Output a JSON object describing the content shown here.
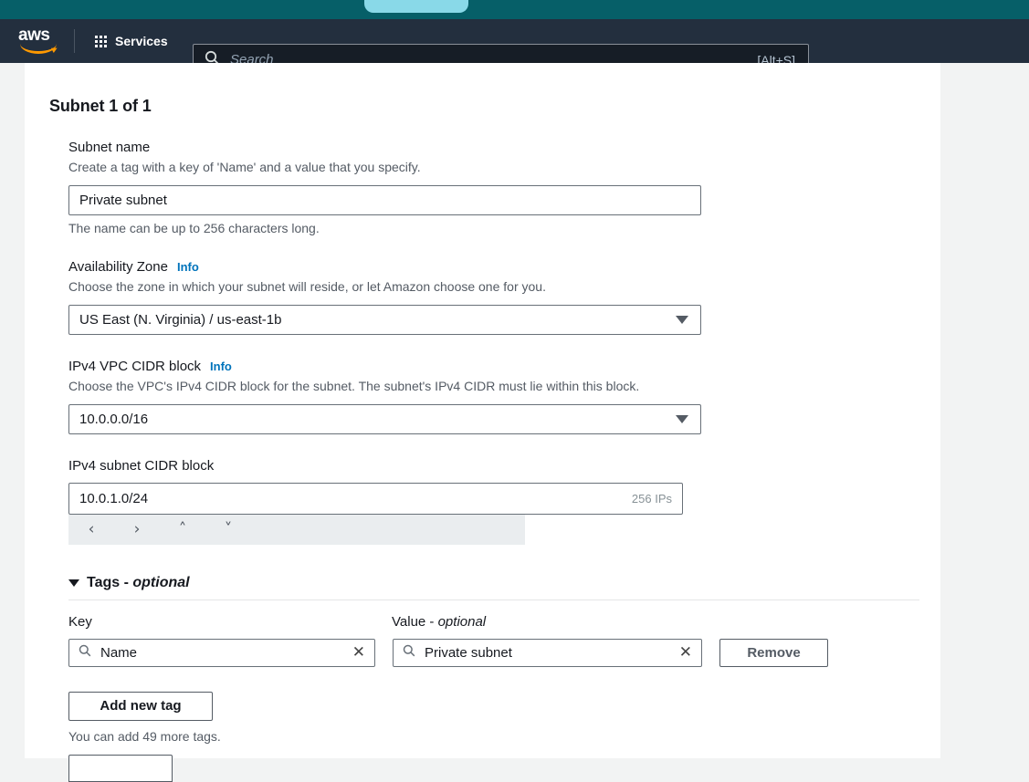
{
  "browser": {
    "tab_strip_color": "#065f68",
    "active_tab_color": "#89d9e8"
  },
  "header": {
    "logo_text": "aws",
    "services_label": "Services",
    "services_icon": "grid-icon",
    "search": {
      "icon": "search-icon",
      "placeholder": "Search",
      "shortcut": "[Alt+S]"
    }
  },
  "main": {
    "section_title": "Subnet 1 of 1",
    "fields": {
      "subnet_name": {
        "label": "Subnet name",
        "description": "Create a tag with a key of 'Name' and a value that you specify.",
        "value": "Private subnet",
        "hint": "The name can be up to 256 characters long."
      },
      "availability_zone": {
        "label": "Availability Zone",
        "info": "Info",
        "description": "Choose the zone in which your subnet will reside, or let Amazon choose one for you.",
        "value": "US East (N. Virginia) / us-east-1b"
      },
      "vpc_cidr": {
        "label": "IPv4 VPC CIDR block",
        "info": "Info",
        "description": "Choose the VPC's IPv4 CIDR block for the subnet. The subnet's IPv4 CIDR must lie within this block.",
        "value": "10.0.0.0/16"
      },
      "subnet_cidr": {
        "label": "IPv4 subnet CIDR block",
        "value": "10.0.1.0/24",
        "ip_count": "256 IPs",
        "stepper": {
          "prev": "‹",
          "next": "›",
          "up": "˄",
          "down": "˅"
        }
      }
    },
    "tags": {
      "title": "Tags - ",
      "title_optional": "optional",
      "key_label": "Key",
      "value_label": "Value - ",
      "value_label_optional": "optional",
      "rows": [
        {
          "key": "Name",
          "value": "Private subnet",
          "clear": "✕",
          "remove_label": "Remove"
        }
      ],
      "add_button": "Add new tag",
      "remaining": "You can add 49 more tags."
    }
  },
  "colors": {
    "aws_header_bg": "#232f3e",
    "aws_orange": "#ff9900",
    "link_blue": "#0073bb",
    "panel_bg": "#ffffff",
    "page_bg": "#f2f3f3"
  }
}
